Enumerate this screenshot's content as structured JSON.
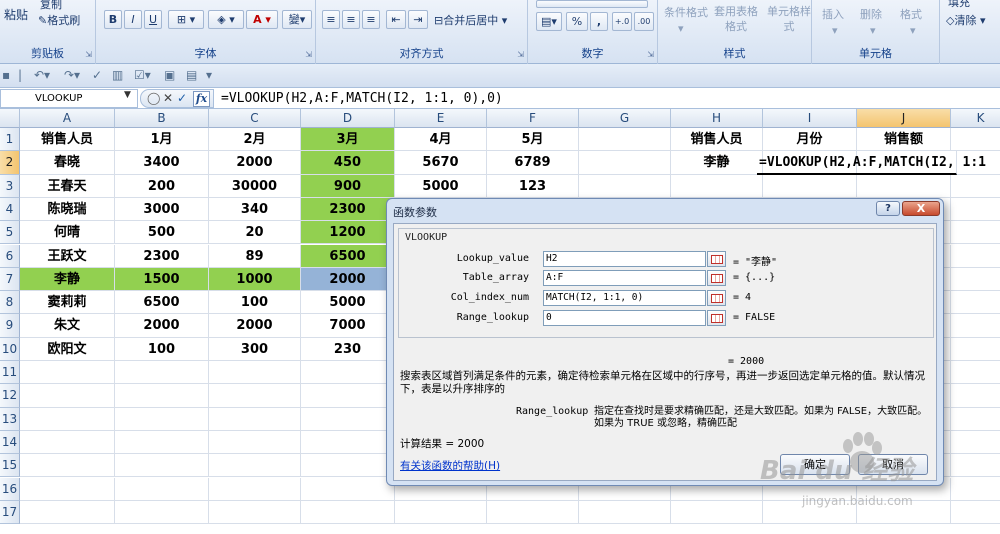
{
  "ribbon": {
    "clipboard": {
      "label": "剪贴板",
      "paste": "粘贴",
      "copy": "复制",
      "format_painter": "格式刷"
    },
    "font": {
      "label": "字体",
      "bold": "B",
      "italic": "I",
      "underline": "U",
      "font_color": "A",
      "phonetic": "變"
    },
    "alignment": {
      "label": "对齐方式",
      "merge": "合并后居中"
    },
    "number": {
      "label": "数字",
      "percent": "%",
      "comma": ","
    },
    "styles": {
      "label": "样式",
      "conditional": "条件格式",
      "table_format": "套用表格格式",
      "cell_styles": "单元格样式"
    },
    "cells": {
      "label": "单元格",
      "insert": "插入",
      "delete": "删除",
      "format": "格式"
    },
    "editing": {
      "clear": "清除",
      "fill": "填充"
    }
  },
  "formula_bar": {
    "name_box": "VLOOKUP",
    "fx": "fx",
    "formula": "=VLOOKUP(H2,A:F,MATCH(I2, 1:1, 0),0)"
  },
  "grid": {
    "columns": [
      "A",
      "B",
      "C",
      "D",
      "E",
      "F",
      "G",
      "H",
      "I",
      "J",
      "K"
    ],
    "rows": [
      "1",
      "2",
      "3",
      "4",
      "5",
      "6",
      "7",
      "8",
      "9",
      "10",
      "11",
      "12",
      "13",
      "14",
      "15",
      "16",
      "17"
    ],
    "data": [
      [
        "销售人员",
        "1月",
        "2月",
        "3月",
        "4月",
        "5月"
      ],
      [
        "春晓",
        "3400",
        "2000",
        "450",
        "5670",
        "6789"
      ],
      [
        "王春天",
        "200",
        "30000",
        "900",
        "5000",
        "123"
      ],
      [
        "陈晓瑞",
        "3000",
        "340",
        "2300",
        "",
        ""
      ],
      [
        "何晴",
        "500",
        "20",
        "1200",
        "",
        ""
      ],
      [
        "王跃文",
        "2300",
        "89",
        "6500",
        "",
        ""
      ],
      [
        "李静",
        "1500",
        "1000",
        "2000",
        "",
        ""
      ],
      [
        "窦莉莉",
        "6500",
        "100",
        "5000",
        "",
        ""
      ],
      [
        "朱文",
        "2000",
        "2000",
        "7000",
        "",
        ""
      ],
      [
        "欧阳文",
        "100",
        "300",
        "230",
        "",
        ""
      ]
    ],
    "lookup": {
      "h1": "销售人员",
      "i1": "月份",
      "j1": "销售额",
      "h2": "李静",
      "j2": "=VLOOKUP(H2,A:F,MATCH(I2, 1:1"
    }
  },
  "dialog": {
    "title": "函数参数",
    "function_name": "VLOOKUP",
    "args": [
      {
        "label": "Lookup_value",
        "value": "H2",
        "result": "= \"李静\""
      },
      {
        "label": "Table_array",
        "value": "A:F",
        "result": "= {...}"
      },
      {
        "label": "Col_index_num",
        "value": "MATCH(I2, 1:1, 0)",
        "result": "= 4"
      },
      {
        "label": "Range_lookup",
        "value": "0",
        "result": "= FALSE"
      }
    ],
    "result_preview": "= 2000",
    "description": "搜索表区域首列满足条件的元素，确定待检索单元格在区域中的行序号，再进一步返回选定单元格的值。默认情况下，表是以升序排序的",
    "arg_name": "Range_lookup",
    "arg_description": "指定在查找时是要求精确匹配，还是大致匹配。如果为 FALSE，大致匹配。如果为 TRUE 或忽略，精确匹配",
    "calc_result": "计算结果 = 2000",
    "help_link": "有关该函数的帮助(H)",
    "ok": "确定",
    "cancel": "取消",
    "help_btn": "?",
    "close_btn": "X"
  },
  "watermark": {
    "text": "Bai du 经验",
    "url": "jingyan.baidu.com"
  },
  "colors": {
    "highlight_green": "#92d050",
    "highlight_blue": "#95b3d7",
    "selected_header": "#f3c46f"
  }
}
